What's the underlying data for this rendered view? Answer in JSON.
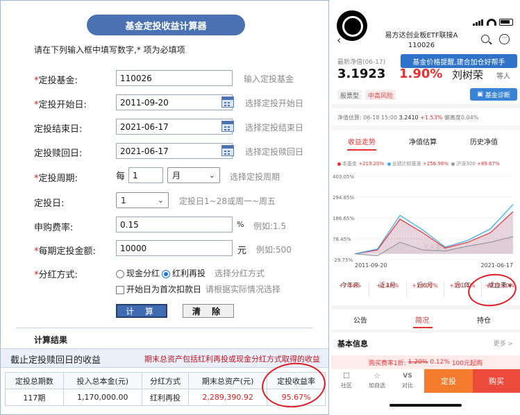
{
  "left": {
    "title": "基金定投收益计算器",
    "instruction": "请在下列输入框中填写数字,* 项为必填项",
    "fields": {
      "fund": {
        "label": "定投基金:",
        "value": "110026",
        "hint": "输入定投基金",
        "required": true
      },
      "start": {
        "label": "定投开始日:",
        "value": "2011-09-20",
        "hint": "选择定投开始日",
        "required": true
      },
      "end": {
        "label": "定投结束日:",
        "value": "2021-06-17",
        "hint": "选择定投结束日",
        "required": false
      },
      "redeem": {
        "label": "定投赎回日:",
        "value": "2021-06-17",
        "hint": "选择定投赎回日",
        "required": false
      },
      "period": {
        "label": "定投周期:",
        "prefix": "每",
        "value": "1",
        "unit": "月",
        "hint": "选择定投周期",
        "required": true
      },
      "day": {
        "label": "定投日:",
        "value": "1",
        "hint": "定投日1~28或周一~周五",
        "required": false
      },
      "fee": {
        "label": "申购费率:",
        "value": "0.15",
        "suffix": "%",
        "hint": "例如:1.5",
        "required": false
      },
      "amount": {
        "label": "每期定投金额:",
        "value": "10000",
        "suffix": "元",
        "hint": "例如:500",
        "required": true
      },
      "dividend": {
        "label": "分红方式:",
        "option1": "现金分红",
        "option2": "红利再投",
        "selected": "红利再投",
        "hint": "选择分红方式",
        "required": true
      },
      "firstday": {
        "label": "开始日为首次扣款日",
        "hint": "请根据实际情况选择"
      }
    },
    "buttons": {
      "calc": "计 算",
      "clear": "清 除"
    },
    "result": {
      "heading": "计算结果",
      "caption": "截止定投赎回日的收益",
      "note": "期末总资产包括红利再投或现金分红方式取得的收益",
      "columns": [
        "定投总期数",
        "投入总本金(元)",
        "分红方式",
        "期末总资产(元)",
        "定投收益率"
      ],
      "row": [
        "117期",
        "1,170,000.00",
        "红利再投",
        "2,289,390.92",
        "95.67%"
      ]
    }
  },
  "right": {
    "fund_name": "易方达创业板ETF联接A",
    "fund_code": "110026",
    "nav_label": "最新净值(06-17)",
    "nav": "3.1923",
    "change": "1.90%",
    "manager": "刘树荣",
    "manager_suffix": "等人",
    "tooltip": "基金价格提醒,建合加仓好帮手",
    "tags": [
      "股票型",
      "中高风险"
    ],
    "diagnose": "基金诊断",
    "estimate": {
      "prefix": "净值估算: 06-18 15:00",
      "value": "3.2410",
      "change": "+1.53%",
      "deviation": "偏离度0.04%"
    },
    "tabs": [
      "收益走势",
      "净值估算",
      "历史净值"
    ],
    "legend": [
      {
        "name": "本基金",
        "value": "+219.20%",
        "color": "#e83030"
      },
      {
        "name": "业绩比较基准",
        "value": "+256.96%",
        "color": "#3fa9f5"
      },
      {
        "name": "沪深300",
        "value": "+89.67%",
        "color": "#999999"
      }
    ],
    "watermark": "天天基金",
    "periods": [
      {
        "label": "今年来",
        "value": "+7.54%"
      },
      {
        "label": "近1月",
        "value": "+2.48%"
      },
      {
        "label": "近6月",
        "value": "+14.00%"
      },
      {
        "label": "近1年",
        "value": "+39.11%"
      },
      {
        "label": "成立来",
        "value": "+219.20%"
      }
    ],
    "tabs2": [
      "公告",
      "简况",
      "持仓"
    ],
    "basic_info": "基本信息",
    "more": "更多 >",
    "fee_text": {
      "prefix": "购买费率1折:",
      "old": "1.20%",
      "new": "0.12%",
      "tail": "100元起购"
    },
    "bottom": [
      "社区",
      "加自选",
      "对比"
    ],
    "bottom_icons": [
      "chat-icon",
      "star-icon",
      "vs-icon"
    ],
    "actions": {
      "invest": "定投",
      "buy": "购买"
    }
  },
  "chart_data": {
    "type": "line",
    "x": [
      "2011-09-20",
      "2013-06",
      "2015-06",
      "2016-06",
      "2018-10",
      "2019-06",
      "2020-06",
      "2021-06-17"
    ],
    "yticks": [
      "403.05%",
      "294.85%",
      "186.65%",
      "78.45%",
      "-29.75%"
    ],
    "xlabels": [
      "2011-09-20",
      "2021-06-17"
    ],
    "ylim": [
      -29.75,
      403.05
    ],
    "series": [
      {
        "name": "本基金",
        "values": [
          0,
          20,
          180,
          110,
          30,
          60,
          110,
          219.2
        ]
      },
      {
        "name": "业绩比较基准",
        "values": [
          0,
          25,
          200,
          125,
          35,
          70,
          130,
          256.96
        ]
      },
      {
        "name": "沪深300",
        "values": [
          0,
          -10,
          60,
          20,
          15,
          40,
          60,
          89.67
        ]
      }
    ]
  }
}
